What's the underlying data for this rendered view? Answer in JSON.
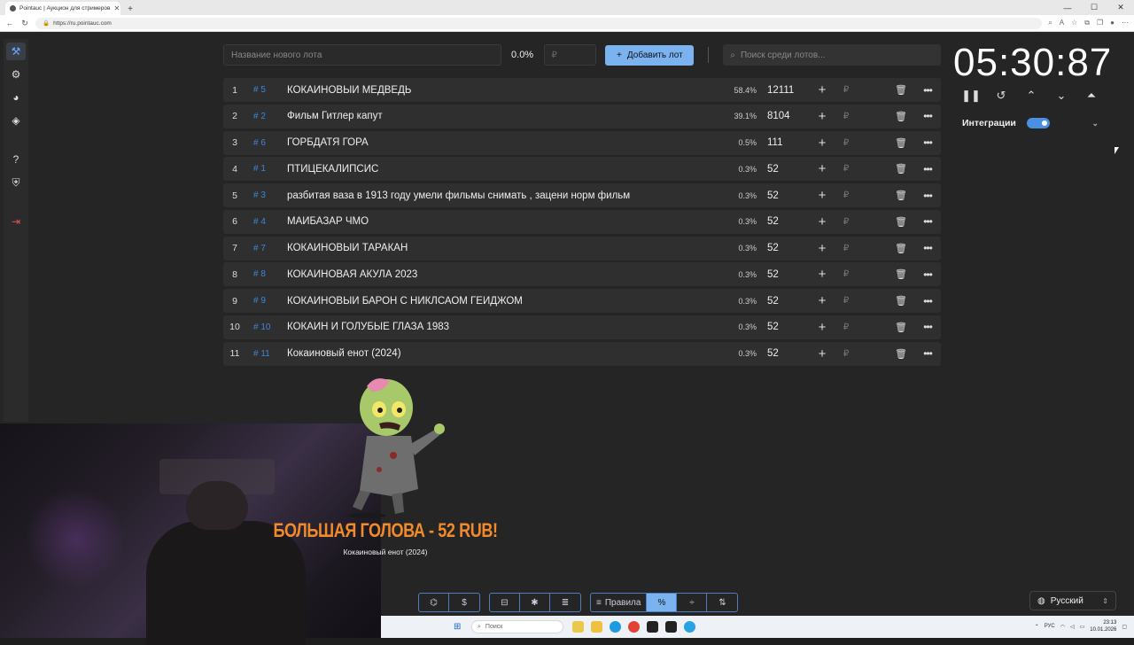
{
  "browser": {
    "tab_title": "Pointauc | Аукцион для стримеров",
    "url": "https://ru.pointauc.com"
  },
  "topbar": {
    "lot_placeholder": "Название нового лота",
    "percent": "0.0%",
    "currency_placeholder": "₽",
    "add_label": "Добавить лот",
    "search_placeholder": "Поиск среди лотов..."
  },
  "lots": [
    {
      "index": "1",
      "id": "# 5",
      "name": "КОКАИНОВЫЙ МЕДВЕДЬ",
      "percent": "58.4%",
      "amount": "12111"
    },
    {
      "index": "2",
      "id": "# 2",
      "name": "Фильм Гитлер капут",
      "percent": "39.1%",
      "amount": "8104"
    },
    {
      "index": "3",
      "id": "# 6",
      "name": "ГОРБДАТЯ ГОРА",
      "percent": "0.5%",
      "amount": "111"
    },
    {
      "index": "4",
      "id": "# 1",
      "name": "ПТИЦЕКАЛИПСИС",
      "percent": "0.3%",
      "amount": "52"
    },
    {
      "index": "5",
      "id": "# 3",
      "name": "разбитая ваза в 1913 году умели фильмы снимать , зацени норм фильм",
      "percent": "0.3%",
      "amount": "52"
    },
    {
      "index": "6",
      "id": "# 4",
      "name": "МАЙБАЗАР ЧМО",
      "percent": "0.3%",
      "amount": "52"
    },
    {
      "index": "7",
      "id": "# 7",
      "name": "КОКАИНОВЫЙ ТАРАКАН",
      "percent": "0.3%",
      "amount": "52"
    },
    {
      "index": "8",
      "id": "# 8",
      "name": "КОКАИНОВАЯ АКУЛА 2023",
      "percent": "0.3%",
      "amount": "52"
    },
    {
      "index": "9",
      "id": "# 9",
      "name": "КОКАИНОВЫЙ БАРОН С НИКЛСАОМ ГЕЙДЖОМ",
      "percent": "0.3%",
      "amount": "52"
    },
    {
      "index": "10",
      "id": "# 10",
      "name": "КОКАИН И ГОЛУБЫЕ ГЛАЗА 1983",
      "percent": "0.3%",
      "amount": "52"
    },
    {
      "index": "11",
      "id": "# 11",
      "name": "Кокаиновый енот (2024)",
      "percent": "0.3%",
      "amount": "52"
    }
  ],
  "lot_row": {
    "plus": "+",
    "rub": "₽",
    "trash": "🗑",
    "more": "•••"
  },
  "timer": {
    "value": "05:30:87"
  },
  "integrations": {
    "label": "Интеграции",
    "enabled": true
  },
  "winner": {
    "title": "БОЛЬШАЯ ГОЛОВА - 52 RUB!",
    "subtitle": "Кокаиновый енот (2024)"
  },
  "bottom": {
    "rules_label": "Правила"
  },
  "language": {
    "selected": "Русский"
  },
  "taskbar": {
    "search_placeholder": "Поиск",
    "lang": "РУС",
    "time": "23:13",
    "date": "10.01.2026"
  },
  "colors": {
    "accent": "#7ab3f0",
    "id_blue": "#3d87d8",
    "winner_orange": "#f08a2a",
    "background": "#252525"
  }
}
